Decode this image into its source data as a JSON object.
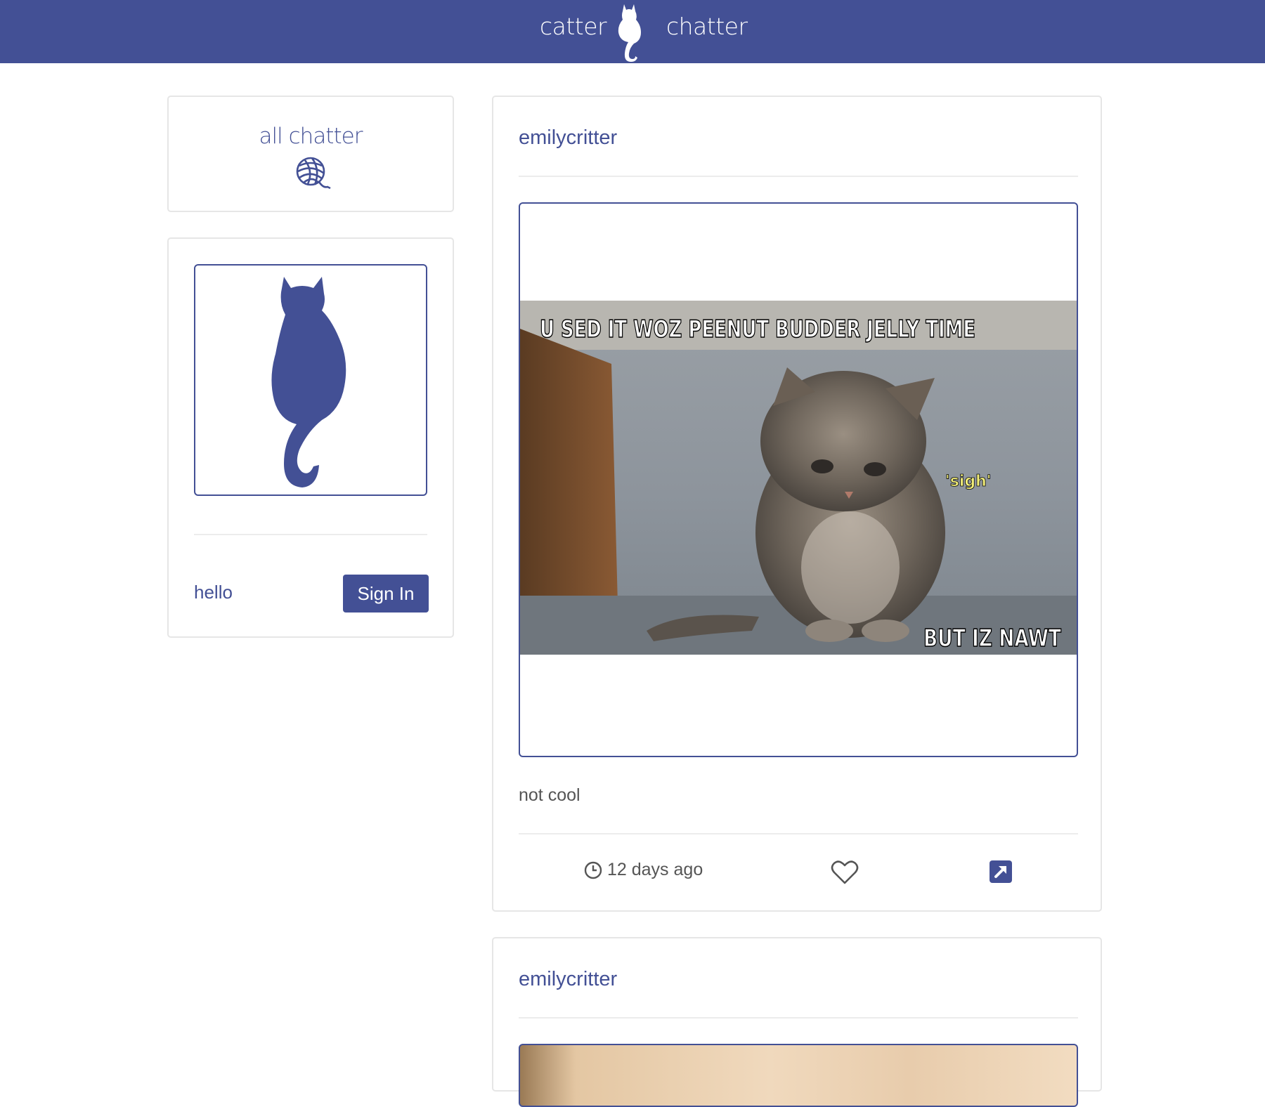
{
  "header": {
    "brand_left": "catter",
    "brand_right": "chatter",
    "logo_icon": "cat-silhouette-icon",
    "background": "#435095"
  },
  "sidebar": {
    "nav": {
      "label": "all chatter",
      "icon": "yarn-ball-icon"
    },
    "login": {
      "avatar_icon": "cat-silhouette-icon",
      "greeting": "hello",
      "signin_label": "Sign In"
    }
  },
  "posts": [
    {
      "author": "emilycritter",
      "image": {
        "top_text": "U SED IT WOZ PEENUT BUDDER JELLY TIME",
        "side_text": "'sigh'",
        "bottom_text": "BUT IZ NAWT"
      },
      "caption": "not cool",
      "time": "12 days ago",
      "like_icon": "heart-outline-icon",
      "share_icon": "external-link-icon"
    },
    {
      "author": "emilycritter"
    }
  ],
  "colors": {
    "accent": "#435095",
    "border": "#e6e6e6",
    "text": "#555555"
  }
}
